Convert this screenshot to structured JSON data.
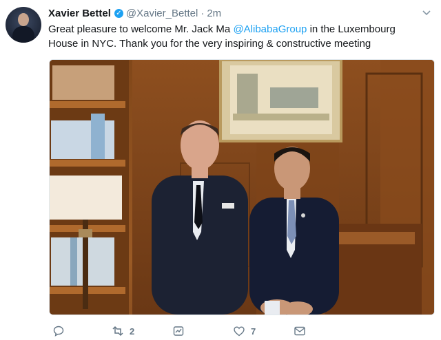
{
  "tweet": {
    "author_name": "Xavier Bettel",
    "handle": "@Xavier_Bettel",
    "separator": "·",
    "time": "2m",
    "text_line1_prefix": "Great pleasure to welcome Mr. Jack Ma ",
    "mention": "@AlibabaGroup",
    "text_line1_suffix": " in the Luxembourg",
    "text_line2": "House in NYC. Thank you for the very inspiring & constructive meeting"
  },
  "actions": {
    "retweet_count": "2",
    "like_count": "7"
  },
  "icons": {
    "verified": "verified-badge-icon",
    "reply": "reply-icon",
    "retweet": "retweet-icon",
    "like": "heart-icon",
    "message": "direct-message-icon",
    "menu": "chevron-down-icon"
  },
  "colors": {
    "link": "#1da1f2",
    "muted": "#657786"
  }
}
